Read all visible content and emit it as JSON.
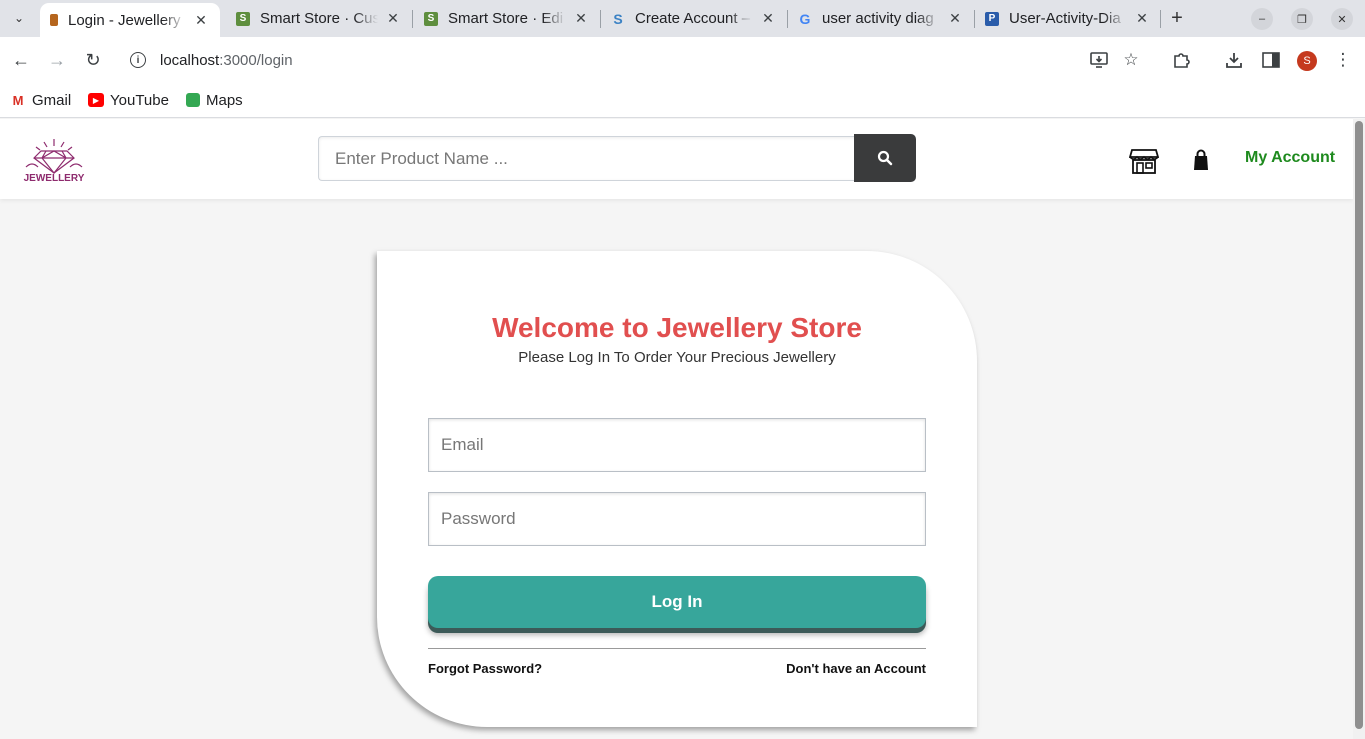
{
  "browser": {
    "tabs": [
      {
        "title": "Login - Jewellery",
        "active": true,
        "favicon": "jewellery-favicon-icon",
        "color": "#b5651d"
      },
      {
        "title": "Smart Store · Cus",
        "active": false,
        "favicon": "shopify-icon",
        "color": "#5e8e3e"
      },
      {
        "title": "Smart Store · Edi",
        "active": false,
        "favicon": "shopify-icon",
        "color": "#5e8e3e"
      },
      {
        "title": "Create Account –",
        "active": false,
        "favicon": "stripe-s-icon",
        "color": "#3b82c4"
      },
      {
        "title": "user activity diag",
        "active": false,
        "favicon": "google-icon",
        "color": "#4285f4"
      },
      {
        "title": "User-Activity-Dia",
        "active": false,
        "favicon": "visual-paradigm-icon",
        "color": "#2a5caa"
      }
    ],
    "url_host": "localhost",
    "url_path": ":3000/login",
    "profile_initial": "S",
    "bookmarks": [
      {
        "label": "Gmail",
        "icon": "gmail-icon"
      },
      {
        "label": "YouTube",
        "icon": "youtube-icon"
      },
      {
        "label": "Maps",
        "icon": "maps-icon"
      }
    ]
  },
  "header": {
    "logo_text": "JEWELLERY",
    "search_placeholder": "Enter Product Name ...",
    "my_account": "My Account"
  },
  "login": {
    "title": "Welcome to Jewellery Store",
    "subtitle": "Please Log In To Order Your Precious Jewellery",
    "email_placeholder": "Email",
    "password_placeholder": "Password",
    "login_button": "Log In",
    "forgot_password": "Forgot Password?",
    "signup_link": "Don't have an Account"
  },
  "colors": {
    "title": "#e14f4f",
    "login_button": "#37a69b",
    "my_account": "#1e8a1e"
  }
}
